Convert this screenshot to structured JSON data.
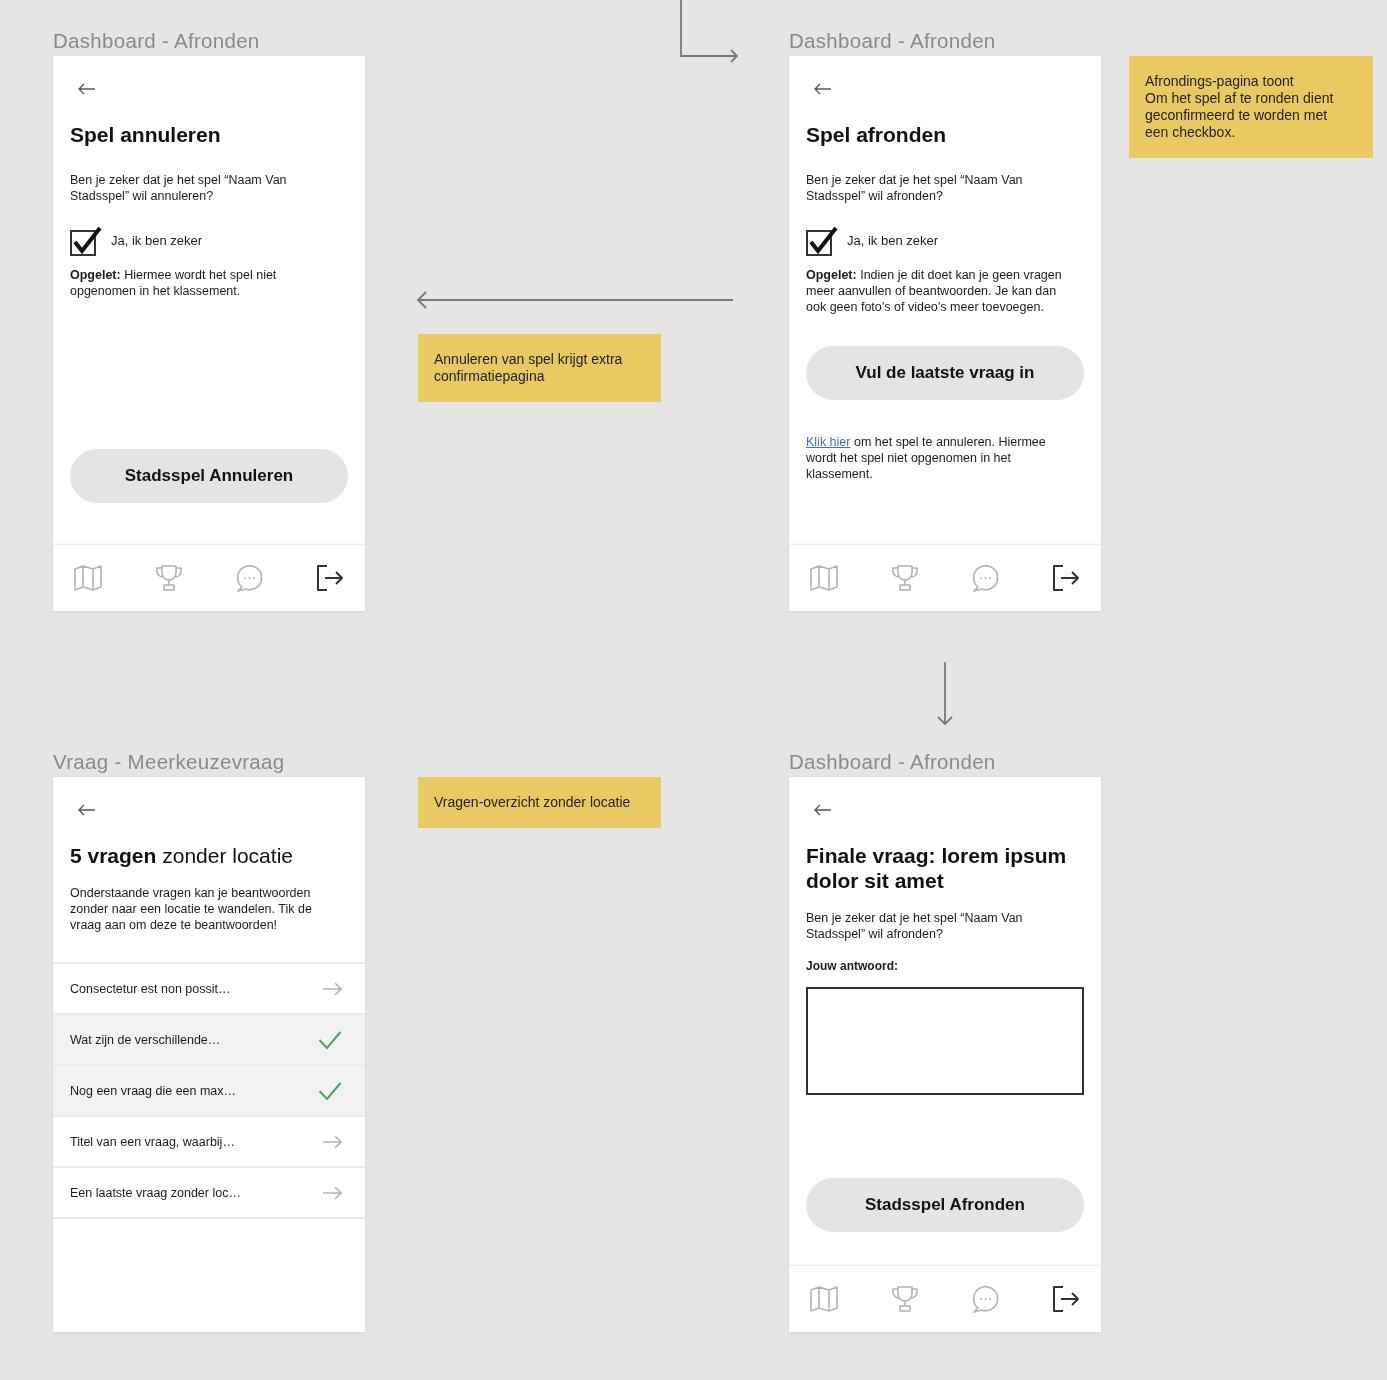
{
  "frames": [
    {
      "kind": "confirm",
      "label": "Dashboard - Afronden",
      "title": "Spel annuleren",
      "intro": "Ben je zeker dat je het spel “Naam Van Stadsspel” wil annuleren?",
      "checkbox": {
        "label": "Ja, ik ben zeker",
        "checked": true
      },
      "warning": "**Opgelet:** Hiermee wordt het spel niet opgenomen in het klassement.",
      "button": "Stadsspel Annuleren",
      "nav_bar": true
    },
    {
      "kind": "confirm",
      "label": "Dashboard - Afronden",
      "title": "Spel afronden",
      "intro": "Ben je zeker dat je het spel “Naam Van Stadsspel” wil afronden?",
      "checkbox": {
        "label": "Ja, ik ben zeker",
        "checked": true
      },
      "warning": "**Opgelet:** Indien je dit doet kan je geen vragen meer aanvullen of beantwoorden. Je kan dan ook geen foto’s of video’s meer toevoegen.",
      "button": "Vul de laatste vraag in",
      "note": {
        "link": "Klik hier",
        "text": "om het spel te annuleren. Hiermee wordt het spel niet opgenomen in het klassement."
      },
      "nav_bar": true
    },
    {
      "kind": "list",
      "label": "Vraag - Meerkeuzevraag",
      "title": "**5 vragen** zonder locatie",
      "intro": "Onderstaande vragen kan je beantwoorden zonder naar een locatie te wandelen. Tik de vraag aan om deze te beantwoorden!",
      "items": [
        {
          "title": "Consectetur est non possit…",
          "answered": false
        },
        {
          "title": "Wat zijn de verschillende…",
          "answered": true
        },
        {
          "title": "Nog een vraag die een max…",
          "answered": true
        },
        {
          "title": "Titel van een vraag, waarbij…",
          "answered": false
        },
        {
          "title": "Een laatste vraag zonder loc…",
          "answered": false
        }
      ]
    },
    {
      "kind": "answer",
      "label": "Dashboard - Afronden",
      "title": "Finale vraag: lorem ipsum dolor sit amet",
      "intro": "Ben je zeker dat je het spel “Naam Van Stadsspel” wil afronden?",
      "answer_label": "Jouw antwoord:",
      "button": "Stadsspel Afronden",
      "nav_bar": true
    }
  ],
  "notes": [
    {
      "text": "Afrondings-pagina toont\nOm het spel af te ronden dient geconfirmeerd te worden met een checkbox."
    },
    {
      "text": "Annuleren van spel krijgt extra confirmatiepagina"
    },
    {
      "text": "Vragen-overzicht zonder locatie"
    }
  ]
}
